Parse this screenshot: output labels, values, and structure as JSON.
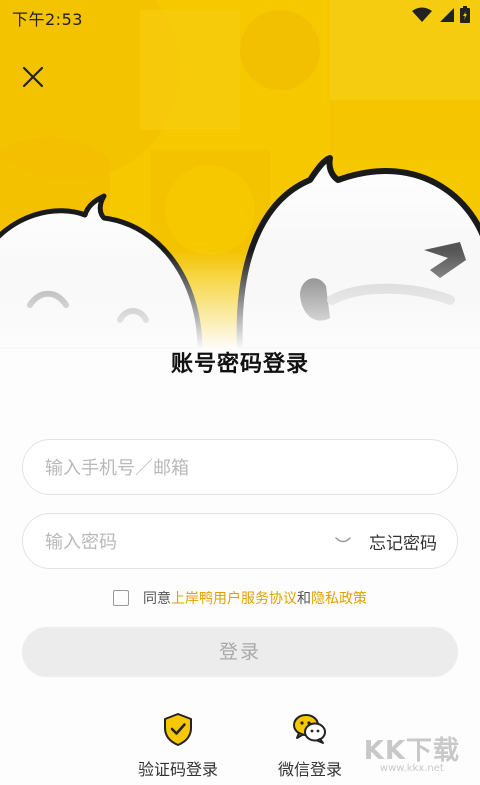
{
  "status_bar": {
    "time": "下午2:53"
  },
  "header": {
    "title": "账号密码登录"
  },
  "form": {
    "phone_placeholder": "输入手机号／邮箱",
    "password_placeholder": "输入密码",
    "forgot_password": "忘记密码"
  },
  "agreement": {
    "prefix": "同意",
    "user_agreement": "上岸鸭用户服务协议",
    "conjunction": "和",
    "privacy_policy": "隐私政策"
  },
  "login_button": "登录",
  "alt_login": {
    "code_login": "验证码登录",
    "wechat_login": "微信登录"
  },
  "watermark": {
    "big": "KK下载",
    "small": "www.kkx.net"
  },
  "colors": {
    "brand_yellow": "#f5c800",
    "link": "#e0a100",
    "disabled_bg": "#ececec"
  }
}
